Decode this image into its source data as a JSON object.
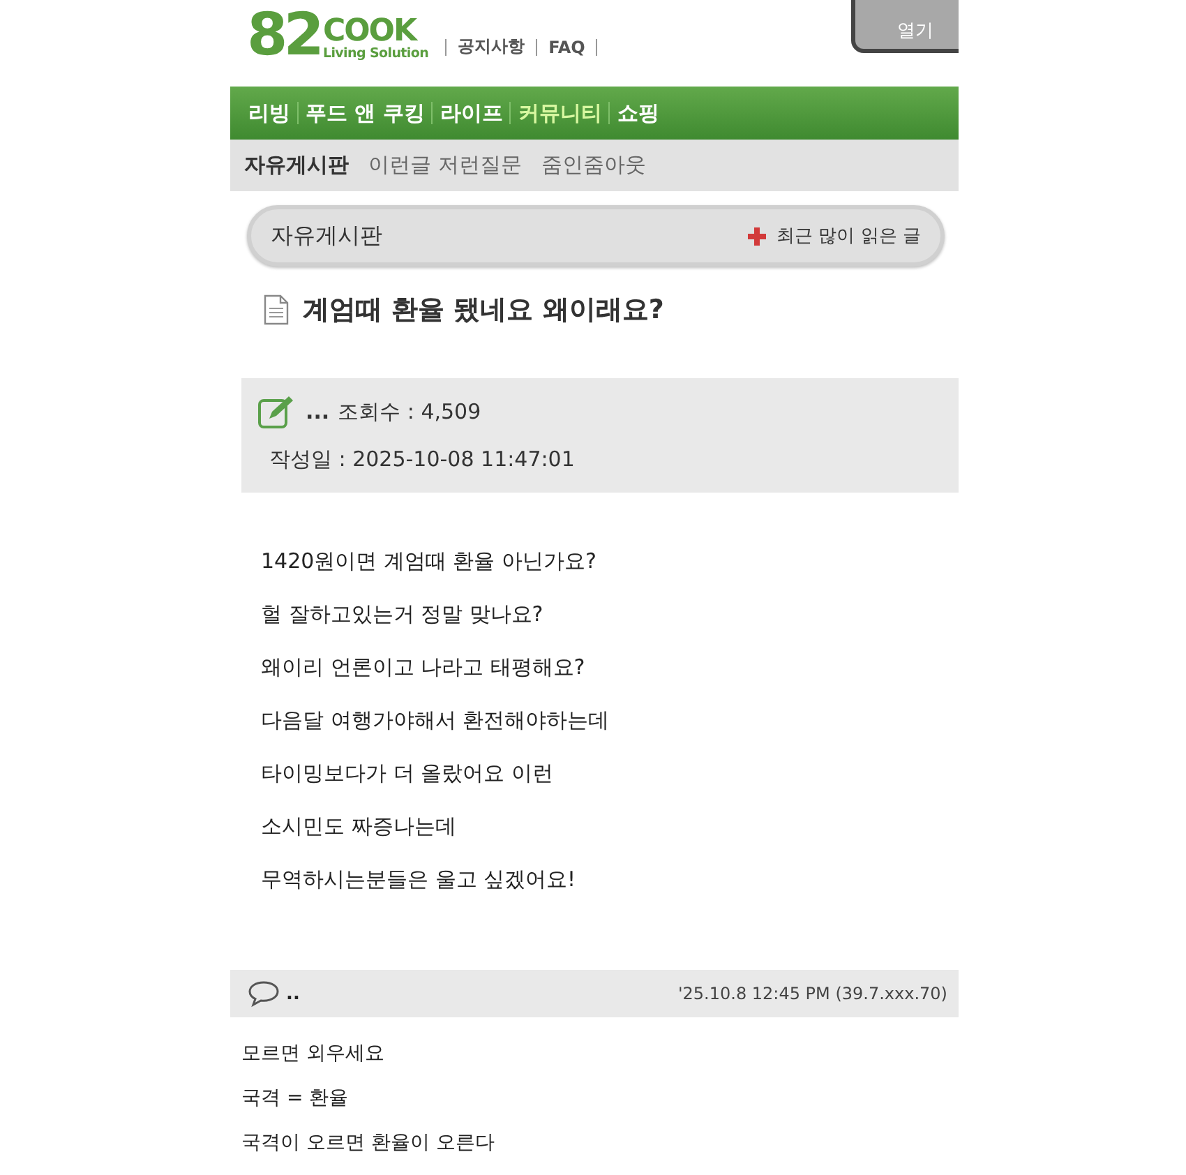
{
  "header": {
    "logo": {
      "mark": "82",
      "word": "COOK",
      "tagline": "Living Solution"
    },
    "links": [
      "공지사항",
      "FAQ"
    ],
    "login_button": "열기"
  },
  "nav": [
    {
      "label": "리빙",
      "selected": false
    },
    {
      "label": "푸드 앤 쿠킹",
      "selected": false
    },
    {
      "label": "라이프",
      "selected": false
    },
    {
      "label": "커뮤니티",
      "selected": true
    },
    {
      "label": "쇼핑",
      "selected": false
    }
  ],
  "subnav": [
    {
      "label": "자유게시판",
      "selected": true
    },
    {
      "label": "이런글 저런질문",
      "selected": false
    },
    {
      "label": "줌인줌아웃",
      "selected": false
    }
  ],
  "board": {
    "title": "자유게시판",
    "popular_link": "최근 많이 읽은 글"
  },
  "post": {
    "title": "계엄때 환율 됐네요 왜이래요?",
    "author": "...",
    "views": "조회수 : 4,509",
    "date": "작성일 : 2025-10-08 11:47:01",
    "body": [
      "1420원이면 계엄때 환율 아닌가요?",
      "헐 잘하고있는거 정말 맞나요?",
      "왜이리 언론이고 나라고 태평해요?",
      "다음달 여행가야해서 환전해야하는데",
      "타이밍보다가 더 올랐어요 이런",
      "소시민도 짜증나는데",
      "무역하시는분들은 울고 싶겠어요!"
    ]
  },
  "comments": [
    {
      "author": "..",
      "meta": "'25.10.8 12:45 PM (39.7.xxx.70)",
      "lines": [
        "모르면 외우세요",
        "국격 = 환율",
        "국격이 오르면 환율이 오른다"
      ]
    }
  ]
}
